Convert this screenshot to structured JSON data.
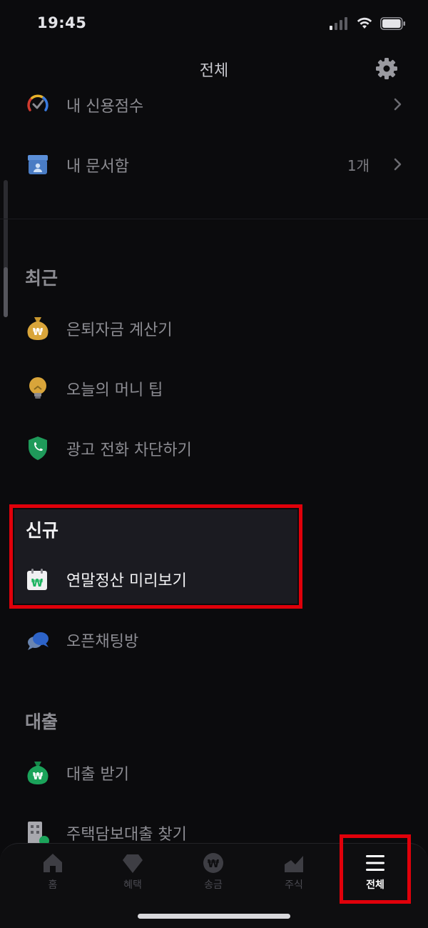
{
  "status_bar": {
    "time": "19:45"
  },
  "header": {
    "title": "전체"
  },
  "top_items": [
    {
      "label": "내 신용점수",
      "icon": "credit-score-gauge-icon"
    },
    {
      "label": "내 문서함",
      "count": "1개",
      "icon": "document-box-icon"
    }
  ],
  "recent": {
    "title": "최근",
    "items": [
      {
        "label": "은퇴자금 계산기",
        "icon": "money-bag-icon"
      },
      {
        "label": "오늘의 머니 팁",
        "icon": "lightbulb-icon"
      },
      {
        "label": "광고 전화 차단하기",
        "icon": "shield-phone-icon"
      }
    ]
  },
  "new_section": {
    "title": "신규",
    "items": [
      {
        "label": "연말정산 미리보기",
        "icon": "won-calendar-icon"
      }
    ]
  },
  "open_chat": {
    "label": "오픈채팅방",
    "icon": "chat-bubbles-icon"
  },
  "loan": {
    "title": "대출",
    "items": [
      {
        "label": "대출 받기",
        "icon": "money-bag-green-icon"
      },
      {
        "label": "주택담보대출 찾기",
        "icon": "building-icon"
      }
    ]
  },
  "tab_bar": {
    "tabs": [
      {
        "label": "홈",
        "icon": "home-icon"
      },
      {
        "label": "혜택",
        "icon": "gem-icon"
      },
      {
        "label": "송금",
        "icon": "won-coin-icon"
      },
      {
        "label": "주식",
        "icon": "stock-chart-icon"
      },
      {
        "label": "전체",
        "icon": "menu-icon",
        "active": true
      }
    ]
  },
  "colors": {
    "background": "#0b0b0d",
    "highlight": "#e0000a",
    "accent_green": "#1bb35f"
  }
}
